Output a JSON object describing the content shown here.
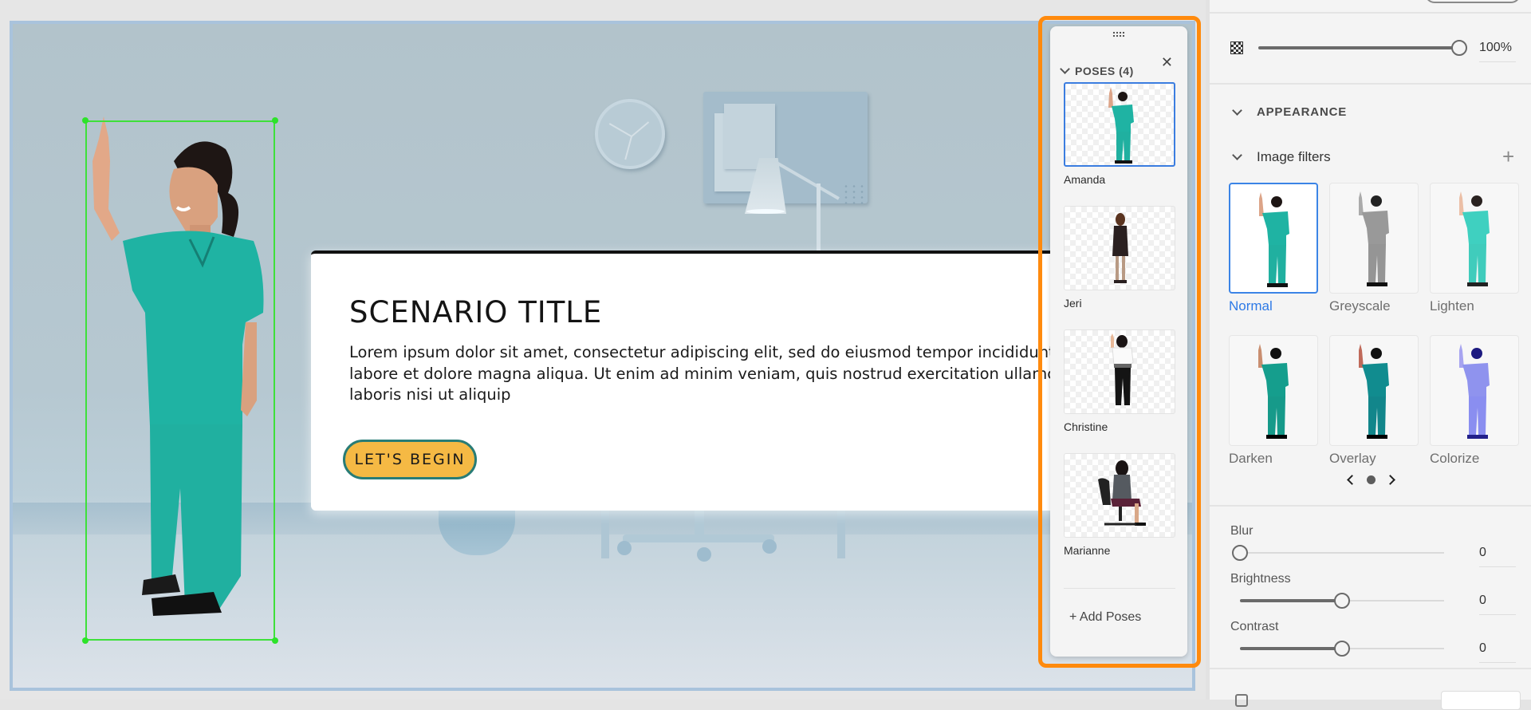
{
  "canvas": {
    "scenario_title": "SCENARIO TITLE",
    "scenario_body": "Lorem ipsum dolor sit amet, consectetur adipiscing elit, sed do eiusmod tempor incididunt ut\nlabore et dolore magna aliqua. Ut enim ad minim veniam, quis nostrud exercitation ullamco\nlaboris nisi ut aliquip",
    "begin_button": "LET'S BEGIN",
    "selected_character": "Amanda",
    "selection_color": "#3ee03a",
    "button_color": "#f5b944",
    "button_border_color": "#287c76"
  },
  "poses_panel": {
    "header": "POSES (4)",
    "highlight_color": "#ff8a0d",
    "items": [
      {
        "name": "Amanda",
        "selected": true,
        "outfit": "teal scrubs"
      },
      {
        "name": "Jeri",
        "selected": false,
        "outfit": "black dress"
      },
      {
        "name": "Christine",
        "selected": false,
        "outfit": "white blouse, black pants"
      },
      {
        "name": "Marianne",
        "selected": false,
        "outfit": "seated on office chair"
      }
    ],
    "add_label": "+ Add Poses",
    "icons": {
      "grip": "drag-grip-icon",
      "close": "close-icon",
      "collapse": "chevron-down-icon"
    }
  },
  "properties": {
    "opacity": {
      "value": 100,
      "label": "100%"
    },
    "appearance_label": "APPEARANCE",
    "image_filters_label": "Image filters",
    "filters": [
      {
        "name": "Normal",
        "selected": true
      },
      {
        "name": "Greyscale",
        "selected": false
      },
      {
        "name": "Lighten",
        "selected": false
      },
      {
        "name": "Darken",
        "selected": false
      },
      {
        "name": "Overlay",
        "selected": false
      },
      {
        "name": "Colorize",
        "selected": false
      }
    ],
    "filter_page": {
      "current": 1,
      "total": 1
    },
    "adjustments": [
      {
        "label": "Blur",
        "value": "0",
        "position": 0
      },
      {
        "label": "Brightness",
        "value": "0",
        "position": 0.5
      },
      {
        "label": "Contrast",
        "value": "0",
        "position": 0.5
      }
    ],
    "accent_color": "#2e7ae6"
  }
}
